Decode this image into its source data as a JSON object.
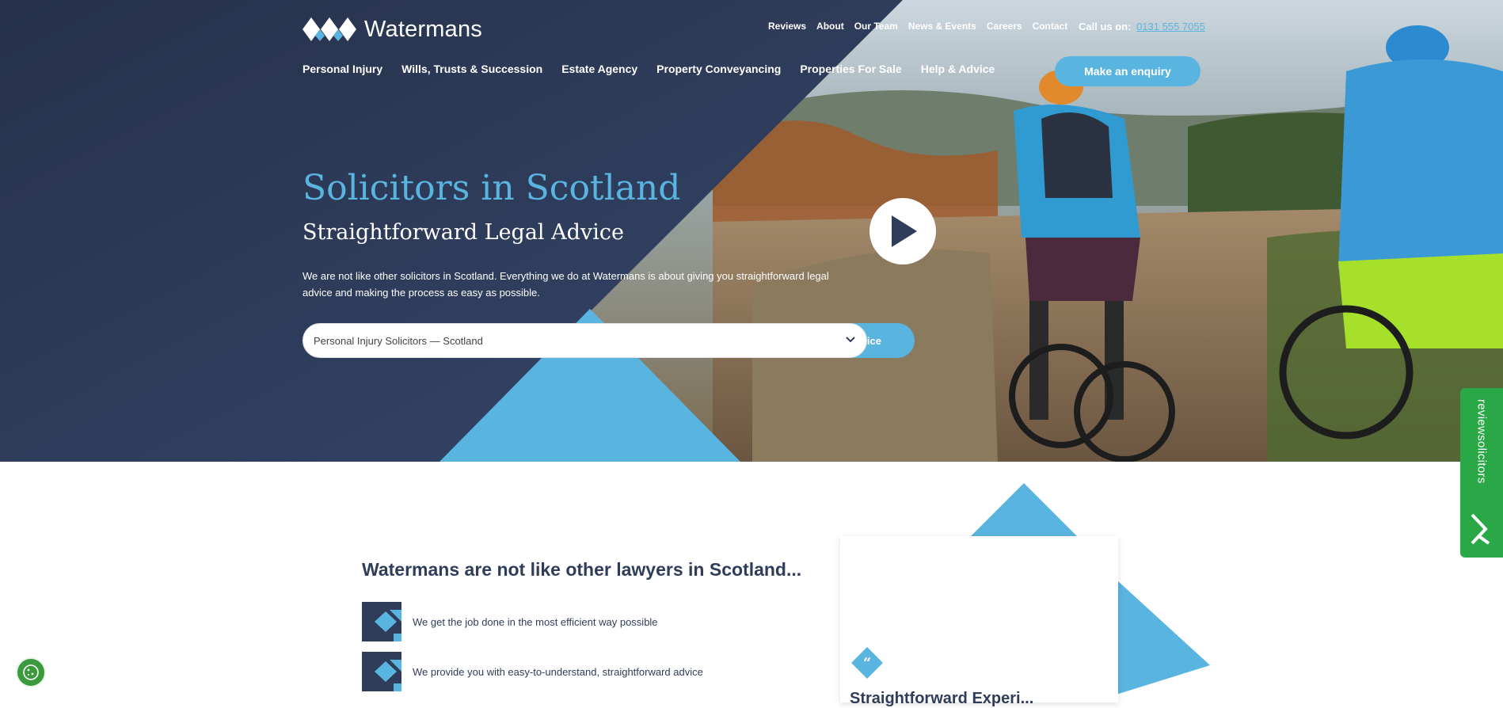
{
  "header": {
    "logo_text": "Watermans",
    "util_nav": [
      "Reviews",
      "About",
      "Our Team",
      "News & Events",
      "Careers",
      "Contact"
    ],
    "call_label": "Call us on:",
    "phone": "0131 555 7055",
    "main_nav": [
      "Personal Injury",
      "Wills, Trusts & Succession",
      "Estate Agency",
      "Property Conveyancing",
      "Properties For Sale",
      "Help & Advice"
    ],
    "enquiry_label": "Make an enquiry"
  },
  "hero": {
    "title": "Solicitors in Scotland",
    "subtitle": "Straightforward Legal Advice",
    "description": "We are not like other solicitors in Scotland. Everything we do at Watermans is about giving you straightforward legal advice and making the process as easy as possible.",
    "select_value": "Personal Injury Solicitors — Scotland",
    "select_button_partial": "ice"
  },
  "review_badge": {
    "label": "reviewsolicitors"
  },
  "lower": {
    "title": "Watermans are not like other lawyers in Scotland...",
    "benefits": [
      "We get the job done in the most efficient way possible",
      "We provide you with easy-to-understand, straightforward advice"
    ],
    "card_title_partial": "Straightforward Experi..."
  },
  "colors": {
    "navy": "#2f3d5a",
    "blue": "#5ab4e0",
    "green": "#2aa746"
  },
  "icons": [
    "diamonds-logo-icon",
    "play-icon",
    "chevron-down-icon",
    "quote-icon",
    "cookie-icon",
    "review-logo-icon"
  ]
}
